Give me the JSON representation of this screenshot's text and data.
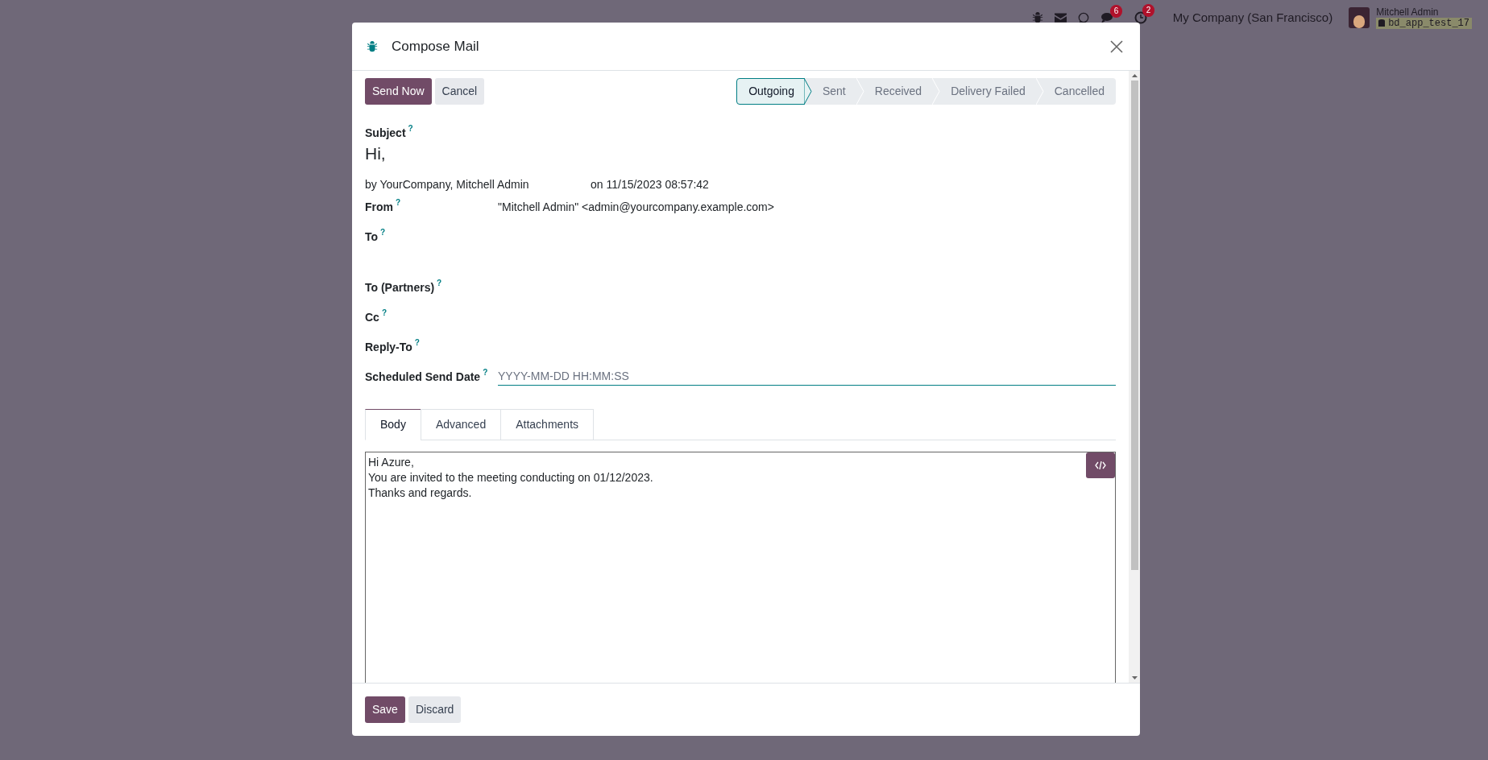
{
  "systray": {
    "chat_badge": "6",
    "activity_badge": "2",
    "company": "My Company (San Francisco)",
    "user_name": "Mitchell Admin",
    "database": "bd_app_test_17"
  },
  "dialog": {
    "title": "Compose Mail",
    "header_buttons": [
      {
        "label": "Send Now",
        "kind": "primary"
      },
      {
        "label": "Cancel",
        "kind": "secondary"
      }
    ],
    "stages": [
      {
        "label": "Outgoing",
        "selected": true
      },
      {
        "label": "Sent",
        "selected": false
      },
      {
        "label": "Received",
        "selected": false
      },
      {
        "label": "Delivery Failed",
        "selected": false
      },
      {
        "label": "Cancelled",
        "selected": false
      }
    ],
    "subject": {
      "label": "Subject",
      "help": "?",
      "value": "Hi,"
    },
    "author": {
      "by": "by YourCompany, Mitchell Admin",
      "date": "on 11/15/2023 08:57:42"
    },
    "fields": [
      {
        "label": "From",
        "help": "?",
        "kind": "text",
        "value": "\"Mitchell Admin\" <admin@yourcompany.example.com>"
      },
      {
        "label": "To",
        "help": "?",
        "kind": "tall"
      },
      {
        "label": "To (Partners)",
        "help": "?",
        "kind": "text"
      },
      {
        "label": "Cc",
        "help": "?",
        "kind": "text"
      },
      {
        "label": "Reply-To",
        "help": "?",
        "kind": "text"
      },
      {
        "label": "Scheduled Send Date",
        "help": "?",
        "kind": "input",
        "placeholder": "YYYY-MM-DD HH:MM:SS"
      }
    ],
    "tabs": [
      {
        "label": "Body",
        "selected": true
      },
      {
        "label": "Advanced",
        "selected": false
      },
      {
        "label": "Attachments",
        "selected": false
      }
    ],
    "body_lines": [
      "Hi Azure,",
      "You are invited to the meeting conducting on 01/12/2023.",
      "Thanks and regards."
    ],
    "footer_buttons": [
      {
        "label": "Save",
        "kind": "primary"
      },
      {
        "label": "Discard",
        "kind": "secondary"
      }
    ]
  }
}
